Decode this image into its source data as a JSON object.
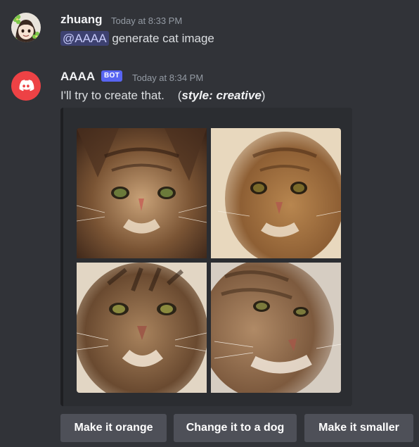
{
  "messages": [
    {
      "username": "zhuang",
      "timestamp": "Today at 8:33 PM",
      "mention": "@AAAA",
      "text": " generate cat image",
      "avatar_icon": "anime-avatar-with-flowers"
    },
    {
      "username": "AAAA",
      "badge": "BOT",
      "timestamp": "Today at 8:34 PM",
      "text": "I'll try to create that.",
      "style_open": "(",
      "style_label": "style: creative",
      "style_close": ")",
      "avatar_icon": "discord-logo-icon"
    }
  ],
  "images": [
    {
      "name": "cat-image-1",
      "icon": "cat-photo"
    },
    {
      "name": "cat-image-2",
      "icon": "cat-photo"
    },
    {
      "name": "cat-image-3",
      "icon": "cat-photo"
    },
    {
      "name": "cat-image-4",
      "icon": "cat-photo"
    }
  ],
  "buttons": [
    {
      "label": "Make it orange"
    },
    {
      "label": "Change it to a dog"
    },
    {
      "label": "Make it smaller"
    }
  ],
  "colors": {
    "background": "#313338",
    "embed_background": "#2b2d31",
    "bot_badge": "#5865f2",
    "discord_red": "#ed4245",
    "button": "#4e5058"
  }
}
